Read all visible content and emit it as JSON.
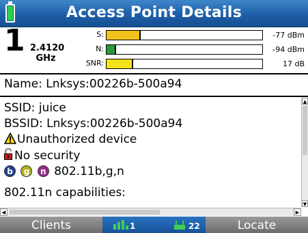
{
  "header": {
    "title": "Access Point Details",
    "battery_level": 1.0,
    "battery_color": "#2bd04a"
  },
  "signal": {
    "channel": "1",
    "frequency": "2.4120",
    "frequency_unit": "GHz",
    "meters": [
      {
        "label": "S:",
        "value": "-77 dBm",
        "level": 0.22,
        "color": "#f1c21b"
      },
      {
        "label": "N:",
        "value": "-94 dBm",
        "level": 0.06,
        "color": "#2a9a3a"
      },
      {
        "label": "SNR:",
        "value": "17 dB",
        "level": 0.17,
        "color": "#f3e21a"
      }
    ]
  },
  "name_line": "Name: Lnksys:00226b-500a94",
  "details": {
    "ssid": "SSID: juice",
    "bssid": "BSSID: Lnksys:00226b-500a94",
    "warning": "Unauthorized device",
    "security": "No security",
    "badges": [
      {
        "letter": "b",
        "color": "#1f3f8f"
      },
      {
        "letter": "g",
        "color": "#b4b21a"
      },
      {
        "letter": "n",
        "color": "#9b2a8e"
      }
    ],
    "standards": "802.11b,g,n",
    "capabilities": "802.11n capabilities:"
  },
  "softkeys": {
    "left": "Clients",
    "center_count_a": "1",
    "center_count_b": "22",
    "right": "Locate"
  },
  "colors": {
    "title_bar": "#1d5ea8",
    "soft_bar": "#7b7b7b"
  }
}
